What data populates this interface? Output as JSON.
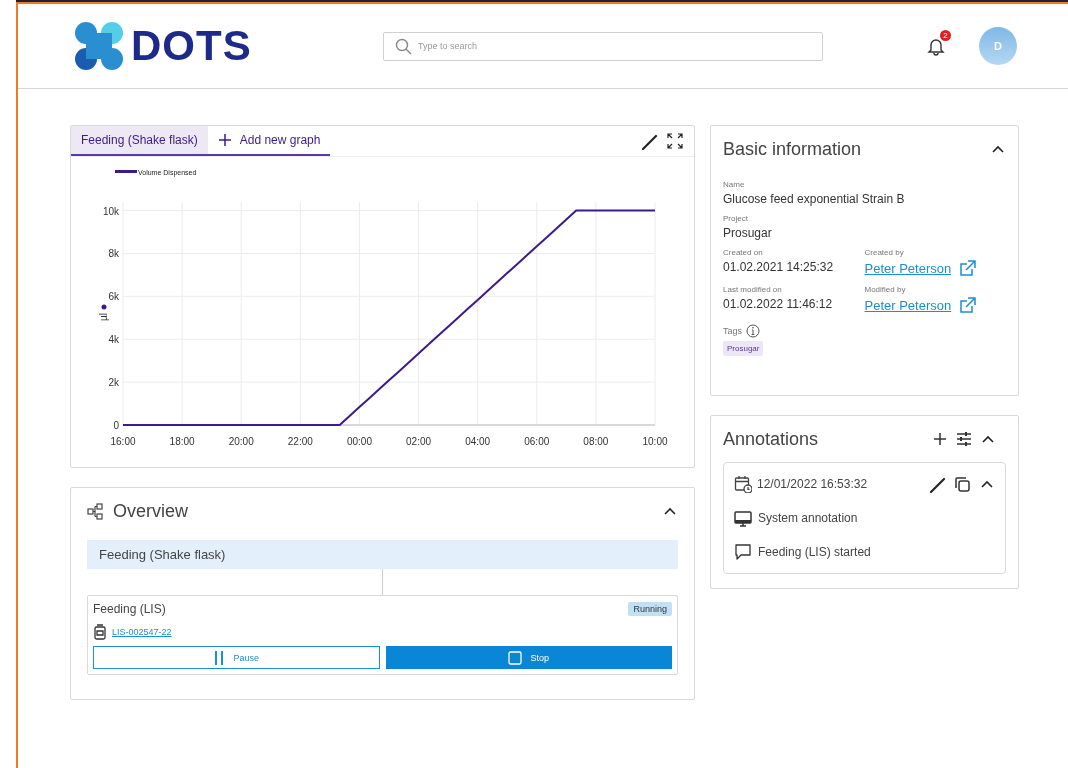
{
  "header": {
    "logo_text": "DOTS",
    "search": {
      "placeholder": "Type to search"
    },
    "notifications": {
      "count": "2"
    },
    "avatar": {
      "initial": "D"
    }
  },
  "graph_panel": {
    "tabs": [
      {
        "label": "Feeding (Shake flask)",
        "selected": true,
        "kind": "tab"
      },
      {
        "label": "Add new graph",
        "selected": false,
        "kind": "add"
      }
    ],
    "chart_data": {
      "type": "line",
      "ylabel": "µl",
      "grid": true,
      "categories": [
        "16:00",
        null,
        null,
        null,
        null,
        null,
        "18:00",
        null,
        null,
        null,
        null,
        null,
        "20:00",
        null,
        null,
        null,
        null,
        null,
        "22:00",
        null,
        null,
        null,
        null,
        null,
        "00:00",
        null,
        null,
        null,
        null,
        null,
        "02:00",
        null,
        null,
        null,
        null,
        null,
        "04:00",
        null,
        null,
        null,
        null,
        null,
        "06:00",
        null,
        null,
        null,
        null,
        null,
        "08:00",
        null,
        null,
        null,
        null,
        null,
        "10:00"
      ],
      "series": [
        {
          "name": "Volume Dispensed",
          "color": "#3d1a8c",
          "values": [
            0,
            0,
            0,
            0,
            0,
            0,
            0,
            0,
            0,
            0,
            0,
            0,
            0,
            0,
            0,
            0,
            0,
            0,
            0,
            0,
            0,
            0,
            0,
            417,
            833,
            1250,
            1667,
            2083,
            2500,
            2917,
            3333,
            3750,
            4167,
            4583,
            5000,
            5417,
            5833,
            6250,
            6667,
            7083,
            7500,
            7917,
            8333,
            8750,
            9167,
            9583,
            10000,
            10000,
            10000,
            10000,
            10000,
            10000,
            10000,
            10000,
            10000
          ]
        }
      ],
      "ylim": [
        0,
        10400
      ],
      "yticks": [
        {
          "value": 0,
          "label": "0"
        },
        {
          "value": 2000,
          "label": "2k"
        },
        {
          "value": 4000,
          "label": "4k"
        },
        {
          "value": 6000,
          "label": "6k"
        },
        {
          "value": 8000,
          "label": "8k"
        },
        {
          "value": 10000,
          "label": "10k"
        }
      ]
    }
  },
  "overview": {
    "title": "Overview",
    "expanded": true,
    "root": {
      "label": "Feeding (Shake flask)"
    },
    "children": [
      {
        "title": "Feeding (LIS)",
        "status": "Running",
        "link": "LIS-002547-22",
        "buttons": [
          {
            "label": "Pause",
            "kind": "pause"
          },
          {
            "label": "Stop",
            "kind": "stop"
          }
        ]
      }
    ]
  },
  "basic_information": {
    "title": "Basic information",
    "expanded": true,
    "rows": [
      [
        {
          "label": "Name",
          "value": "Glucose feed exponential Strain B",
          "kind": "text"
        }
      ],
      [
        {
          "label": "Project",
          "value": "Prosugar",
          "kind": "text"
        }
      ],
      [
        {
          "label": "Created on",
          "value": "01.02.2021 14:25:32",
          "kind": "text"
        },
        {
          "label": "Created by",
          "value": "Peter Peterson",
          "kind": "link"
        }
      ],
      [
        {
          "label": "Last modified on",
          "value": "01.02.2022 11:46:12",
          "kind": "text"
        },
        {
          "label": "Modified by",
          "value": "Peter Peterson",
          "kind": "link"
        }
      ]
    ],
    "tags": {
      "label": "Tags",
      "items": [
        "Prosugar"
      ]
    }
  },
  "annotations": {
    "title": "Annotations",
    "expanded": true,
    "items": [
      {
        "timestamp": "12/01/2022 16:53:32",
        "expanded": true,
        "lines": [
          {
            "kind": "system",
            "text": "System annotation"
          },
          {
            "kind": "comment",
            "text": "Feeding (LIS) started"
          }
        ]
      }
    ]
  }
}
